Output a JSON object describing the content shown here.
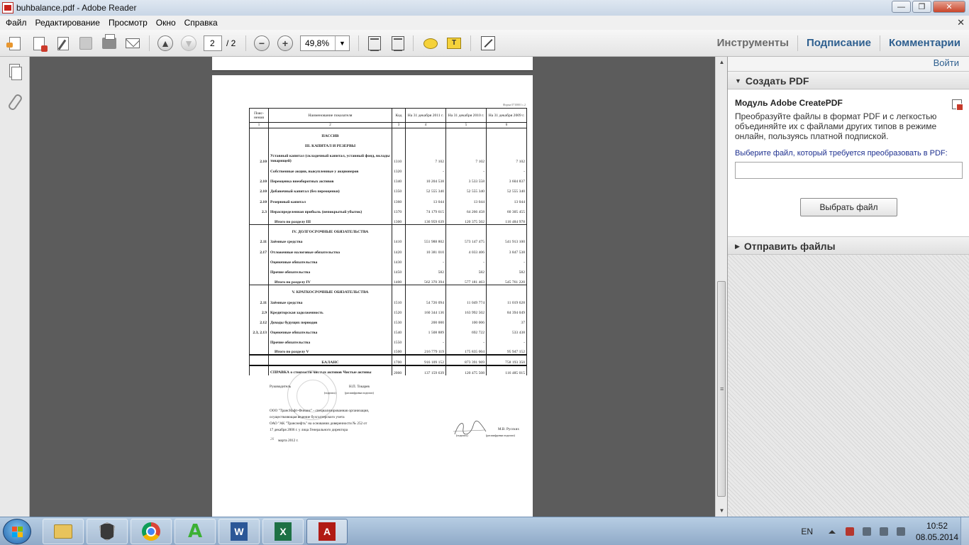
{
  "window": {
    "title": "buhbalance.pdf - Adobe Reader",
    "controls": [
      "—",
      "❐",
      "✕"
    ]
  },
  "menu": [
    "Файл",
    "Редактирование",
    "Просмотр",
    "Окно",
    "Справка"
  ],
  "menu_close": "✕",
  "toolbar": {
    "page_current": "2",
    "page_total": "/ 2",
    "zoom": "49,8%",
    "zoom_dd": "▼",
    "prev_glyph": "▲",
    "next_glyph": "▼",
    "zoom_out_glyph": "−",
    "zoom_in_glyph": "+",
    "highlight_glyph": "T",
    "right_tabs": [
      "Инструменты",
      "Подписание",
      "Комментарии"
    ]
  },
  "pdf": {
    "form_tag": "Форма 0710001 с.2",
    "headers": [
      "Пояс-нения",
      "Наименование показателя",
      "Код",
      "На 31 декабря 2011 г.",
      "На 31 декабря 2010 г.",
      "На 31 декабря 2009 г."
    ],
    "col_numbers": [
      "1",
      "2",
      "3",
      "4",
      "5",
      "6"
    ],
    "rows": [
      {
        "note": "",
        "name": "ПАССИВ",
        "code": "",
        "v1": "",
        "v2": "",
        "v3": ""
      },
      {
        "note": "",
        "name": "III. КАПИТАЛ И РЕЗЕРВЫ",
        "code": "",
        "v1": "",
        "v2": "",
        "v3": ""
      },
      {
        "note": "2.10",
        "name": "Уставный капитал (складочный капитал, уставный фонд, вклады товарищей)",
        "code": "1310",
        "v1": "7 102",
        "v2": "7 102",
        "v3": "7 102"
      },
      {
        "note": "",
        "name": "Собственные акции, выкупленные у акционеров",
        "code": "1320",
        "v1": "-",
        "v2": "-",
        "v3": "-"
      },
      {
        "note": "2.10",
        "name": "Переоценка внеоборотных активов",
        "code": "1340",
        "v1": "10 204 538",
        "v2": "3 533 558",
        "v3": "3 604 837"
      },
      {
        "note": "2.10",
        "name": "Добавочный капитал (без переоценки)",
        "code": "1350",
        "v1": "52 555 340",
        "v2": "52 555 340",
        "v3": "52 555 340"
      },
      {
        "note": "2.10",
        "name": "Резервный капитал",
        "code": "1360",
        "v1": "13 044",
        "v2": "13 044",
        "v3": "13 044"
      },
      {
        "note": "2.3",
        "name": "Нераспределенная прибыль (непокрытый убыток)",
        "code": "1370",
        "v1": "74 179 615",
        "v2": "64 266 458",
        "v3": "60 305 455"
      },
      {
        "note": "",
        "name": "Итого по разделу III",
        "code": "1300",
        "v1": "136 959 639",
        "v2": "120 375 502",
        "v3": "116 484 978"
      },
      {
        "note": "",
        "name": "IV. ДОЛГОСРОЧНЫЕ ОБЯЗАТЕЛЬСТВА",
        "code": "",
        "v1": "",
        "v2": "",
        "v3": ""
      },
      {
        "note": "2.11",
        "name": "Заёмные средства",
        "code": "1410",
        "v1": "551 988 802",
        "v2": "573 147 475",
        "v3": "541 913 100"
      },
      {
        "note": "2.17",
        "name": "Отложенные налоговые обязательства",
        "code": "1420",
        "v1": "10 381 010",
        "v2": "4 033 406",
        "v3": "3 847 538"
      },
      {
        "note": "",
        "name": "Оценочные обязательства",
        "code": "1430",
        "v1": "-",
        "v2": "-",
        "v3": "-"
      },
      {
        "note": "",
        "name": "Прочие обязательства",
        "code": "1450",
        "v1": "582",
        "v2": "582",
        "v3": "582"
      },
      {
        "note": "",
        "name": "Итого по разделу IV",
        "code": "1400",
        "v1": "562 370 394",
        "v2": "577 181 463",
        "v3": "545 761 220"
      },
      {
        "note": "",
        "name": "V. КРАТКОСРОЧНЫЕ ОБЯЗАТЕЛЬСТВА",
        "code": "",
        "v1": "",
        "v2": "",
        "v3": ""
      },
      {
        "note": "2.11",
        "name": "Заёмные средства",
        "code": "1510",
        "v1": "54 726 094",
        "v2": "11 049 774",
        "v3": "11 019 628"
      },
      {
        "note": "2.9",
        "name": "Кредиторская задолженность",
        "code": "1520",
        "v1": "160 344 136",
        "v2": "163 992 502",
        "v3": "84 394 049"
      },
      {
        "note": "2.12",
        "name": "Доходы будущих периодов",
        "code": "1530",
        "v1": "200 000",
        "v2": "100 006",
        "v3": "37"
      },
      {
        "note": "2.3, 2.13",
        "name": "Оценочные обязательства",
        "code": "1540",
        "v1": "1 508 889",
        "v2": "692 722",
        "v3": "533 438"
      },
      {
        "note": "",
        "name": "Прочие обязательства",
        "code": "1550",
        "v1": "-",
        "v2": "-",
        "v3": "-"
      },
      {
        "note": "",
        "name": "Итого по разделу V",
        "code": "1500",
        "v1": "216 779 119",
        "v2": "175 835 004",
        "v3": "95 947 152"
      },
      {
        "note": "",
        "name": "БАЛАНС",
        "code": "1700",
        "v1": "916 109 152",
        "v2": "873 391 969",
        "v3": "758 193 350"
      },
      {
        "note": "",
        "name": "СПРАВКА о стоимости чистых активов Чистые активы",
        "code": "2000",
        "v1": "137 159 639",
        "v2": "120 475 508",
        "v3": "116 485 015"
      }
    ],
    "sig_head_label": "Руководитель",
    "sig_head_name": "Н.П. Токарев",
    "sig_head_sub1": "(подпись)",
    "sig_head_sub2": "(расшифровка подписи)",
    "org_line1": "ООО \"ТрансНафт-Финанс\" - специализированная организация,",
    "org_line2": "осуществляющая ведение бухгалтерского учета",
    "org_line3": "ОАО \"АК \"Транснефть\" на основании доверенности № 252 от",
    "org_line4": "17 декабря 2006 г. у лица Генерального директора",
    "sig2_name": "М.В. Русских",
    "sig2_sub1": "(подпись)",
    "sig2_sub2": "(расшифровка подписи)",
    "date_line": "марта 2012 г.",
    "date_day": "26"
  },
  "rightpane": {
    "signin": "Войти",
    "create_pdf": "Создать PDF",
    "module_title": "Модуль Adobe CreatePDF",
    "description": "Преобразуйте файлы в формат PDF и с легкостью объединяйте их с файлами других типов в режиме онлайн, пользуясь платной подпиской.",
    "prompt": "Выберите файл, который требуется преобразовать в PDF:",
    "choose_button": "Выбрать файл",
    "send_files": "Отправить файлы"
  },
  "scroll_glyphs": {
    "up": "▲",
    "down": "▼",
    "grip": "≡"
  },
  "taskbar": {
    "lang": "EN",
    "time": "10:52",
    "date": "08.05.2014",
    "apps": [
      "windows-explorer",
      "world-of-tanks",
      "google-chrome",
      "a-app",
      "microsoft-word",
      "microsoft-excel",
      "adobe-reader"
    ],
    "word_letter": "W",
    "excel_letter": "X",
    "reader_letter": "A",
    "a_letter": "A"
  }
}
